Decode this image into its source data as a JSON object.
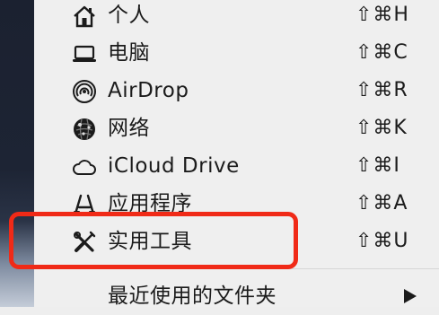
{
  "menu": {
    "items": [
      {
        "label": "个人",
        "shortcut": "⇧⌘H",
        "icon": "home-icon"
      },
      {
        "label": "电脑",
        "shortcut": "⇧⌘C",
        "icon": "laptop-icon"
      },
      {
        "label": "AirDrop",
        "shortcut": "⇧⌘R",
        "icon": "airdrop-icon"
      },
      {
        "label": "网络",
        "shortcut": "⇧⌘K",
        "icon": "network-globe-icon"
      },
      {
        "label": "iCloud Drive",
        "shortcut": "⇧⌘I",
        "icon": "cloud-icon"
      },
      {
        "label": "应用程序",
        "shortcut": "⇧⌘A",
        "icon": "applications-icon"
      },
      {
        "label": "实用工具",
        "shortcut": "⇧⌘U",
        "icon": "utilities-tools-icon"
      },
      {
        "label": "最近使用的文件夹",
        "icon": "submenu-arrow-icon"
      }
    ]
  },
  "colors": {
    "menu_background": "#efefef",
    "text": "#1b1b1b",
    "highlight_outline": "#f02a17"
  }
}
